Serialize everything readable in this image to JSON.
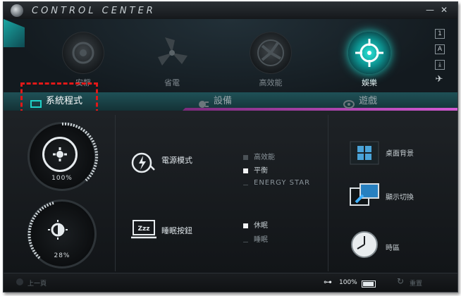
{
  "window": {
    "title": "CONTROL CENTER",
    "minimize": "—",
    "close": "✕"
  },
  "modes": [
    {
      "label": "安靜",
      "icon": "speaker-icon"
    },
    {
      "label": "省電",
      "icon": "fan-icon"
    },
    {
      "label": "高效能",
      "icon": "fan-blade-icon"
    },
    {
      "label": "娛樂",
      "icon": "crosshair-icon"
    }
  ],
  "side_buttons": [
    "1",
    "A",
    "⤓",
    "✈"
  ],
  "tabs": [
    {
      "label": "系統程式",
      "selected": true
    },
    {
      "label": "設備",
      "selected": false
    },
    {
      "label": "遊戲",
      "selected": false
    }
  ],
  "dials": [
    {
      "value": "100%",
      "icon": "volume-icon"
    },
    {
      "value": "28%",
      "icon": "brightness-icon"
    }
  ],
  "power": {
    "title": "電源模式",
    "options": [
      {
        "label": "高效能",
        "checked": false
      },
      {
        "label": "平衡",
        "checked": true
      },
      {
        "label": "ENERGY STAR",
        "checked": false
      }
    ]
  },
  "sleep": {
    "title": "睡眠按鈕",
    "icon_text": "Zzz",
    "options": [
      {
        "label": "休眠",
        "checked": true
      },
      {
        "label": "睡眠",
        "checked": false
      }
    ]
  },
  "right_panel": [
    {
      "label": "桌面背景",
      "icon": "windows-desktop-icon"
    },
    {
      "label": "顯示切換",
      "icon": "display-switch-icon"
    },
    {
      "label": "時區",
      "icon": "clock-icon"
    }
  ],
  "bottom": {
    "back": "上一頁",
    "battery": "100%",
    "reset": "重置"
  },
  "colors": {
    "accent": "#1fd2c8",
    "tab_band": "#1f5157",
    "pink": "#d35ad3",
    "highlight_box": "#e11818"
  }
}
